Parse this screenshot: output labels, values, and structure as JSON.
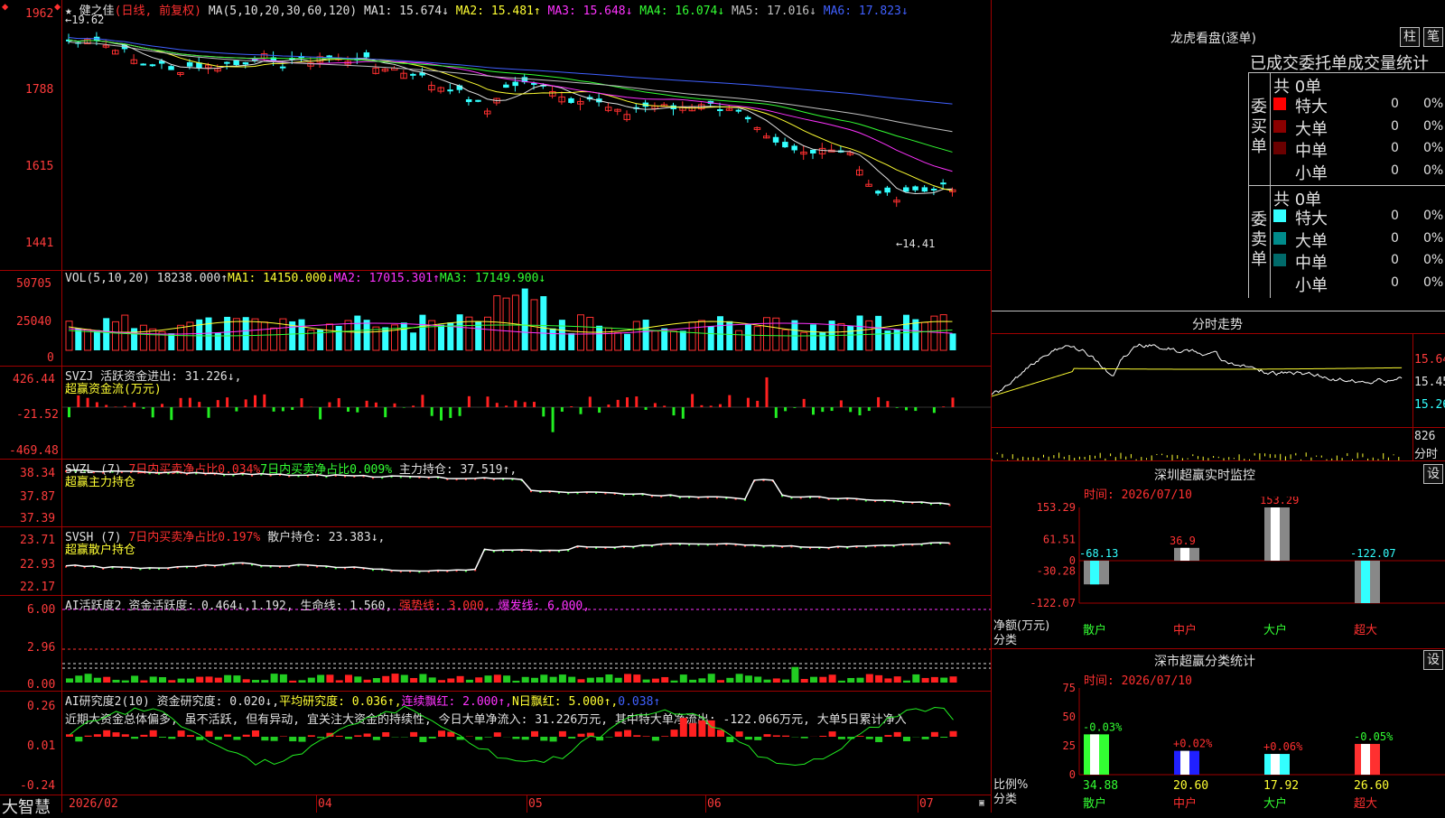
{
  "app": {
    "brand": "大智慧"
  },
  "stock": {
    "name": "健之佳",
    "mode": "(日线, 前复权)"
  },
  "price_panel": {
    "axis": [
      "1962",
      "1788",
      "1615",
      "1441"
    ],
    "ma_title": "MA(5,10,20,30,60,120)",
    "ma": [
      {
        "label": "MA1: 15.674↓",
        "color": "#e0e0e0"
      },
      {
        "label": "MA2: 15.481↑",
        "color": "#ffff33"
      },
      {
        "label": "MA3: 15.648↓",
        "color": "#ff33ff"
      },
      {
        "label": "MA4: 16.074↓",
        "color": "#33ff33"
      },
      {
        "label": "MA5: 17.016↓",
        "color": "#c0c0c0"
      },
      {
        "label": "MA6: 17.823↓",
        "color": "#4060ff"
      }
    ],
    "high_mark": "←19.62",
    "low_mark": "←14.41"
  },
  "vol_panel": {
    "axis": [
      "50705",
      "25040",
      "0"
    ],
    "title": "VOL(5,10,20)",
    "value": "18238.000↑",
    "ma1": "MA1: 14150.000↓",
    "ma2": "MA2: 17015.301↑",
    "ma3": "MA3: 17149.900↓"
  },
  "svzj_panel": {
    "axis": [
      "426.44",
      "-21.52",
      "-469.48"
    ],
    "title": "SVZJ",
    "line1": "活跃资金进出: 31.226↓,",
    "line2": "超赢资金流(万元)"
  },
  "svzl_panel": {
    "axis": [
      "38.34",
      "37.87",
      "37.39"
    ],
    "title": "SVZL (7)",
    "t1": "7日内买卖净占比0.034%",
    "t2": "7日内买卖净占比0.009%",
    "t3": "主力持仓: 37.519↑,",
    "line2": "超赢主力持仓"
  },
  "svsh_panel": {
    "axis": [
      "23.71",
      "22.93",
      "22.17"
    ],
    "title": "SVSH (7)",
    "t1": "7日内买卖净占比0.197%",
    "t2": "散户持仓: 23.383↓,",
    "line2": "超赢散户持仓"
  },
  "ai1_panel": {
    "axis": [
      "6.00",
      "2.96",
      "0.00"
    ],
    "title": "AI活跃度2",
    "t1": "资金活跃度: 0.464↓,1.192,",
    "t2": "生命线: 1.560,",
    "t3": "强势线: 3.000,",
    "t4": "爆发线: 6.000,"
  },
  "ai2_panel": {
    "axis": [
      "0.26",
      "0.01",
      "-0.24"
    ],
    "title": "AI研究度2(10)",
    "t1": "资金研究度: 0.020↓,",
    "t2": "平均研究度: 0.036↑,",
    "t3": "连续飘红: 2.000↑,",
    "t4": "N日飘红: 5.000↑,",
    "t5": "0.038↑",
    "comment": "近期大资金总体偏多, 虽不活跃, 但有异动, 宜关注大资金的持续性, 今日大单净流入: 31.226万元, 其中特大单净流出: -122.066万元, 大单5日累计净入"
  },
  "date_axis": [
    "2026/02",
    "04",
    "05",
    "06",
    "07"
  ],
  "dragon": {
    "title": "龙虎看盘(逐单)",
    "btn_bar": "柱",
    "btn_pen": "笔",
    "subtitle": "已成交委托单成交量统计",
    "buy": {
      "side_label": "委买单",
      "total": "共 0单",
      "rows": [
        {
          "name": "特大",
          "count": "0",
          "pct": "0%",
          "color": "#ff0000"
        },
        {
          "name": "大单",
          "count": "0",
          "pct": "0%",
          "color": "#8b0000"
        },
        {
          "name": "中单",
          "count": "0",
          "pct": "0%",
          "color": "#6a0000"
        },
        {
          "name": "小单",
          "count": "0",
          "pct": "0%",
          "color": "#000000"
        }
      ]
    },
    "sell": {
      "side_label": "委卖单",
      "total": "共 0单",
      "rows": [
        {
          "name": "特大",
          "count": "0",
          "pct": "0%",
          "color": "#33ffff"
        },
        {
          "name": "大单",
          "count": "0",
          "pct": "0%",
          "color": "#008b8b"
        },
        {
          "name": "中单",
          "count": "0",
          "pct": "0%",
          "color": "#006a6a"
        },
        {
          "name": "小单",
          "count": "0",
          "pct": "0%",
          "color": "#000000"
        }
      ]
    }
  },
  "intraday": {
    "title": "分时走势",
    "axis": [
      "15.64",
      "15.45",
      "15.26"
    ],
    "vol_label": "826",
    "unit": "分时"
  },
  "sz_monitor": {
    "title": "深圳超赢实时监控",
    "btn": "设",
    "time": "时间: 2026/07/10",
    "axis": [
      "153.29",
      "61.51",
      "0",
      "-30.28",
      "-122.07"
    ],
    "ylabel1": "净额(万元)",
    "ylabel2": "分类",
    "chart_data": {
      "type": "bar",
      "categories": [
        "散户",
        "中户",
        "大户",
        "超大"
      ],
      "values": [
        -68.13,
        36.9,
        153.29,
        -122.07
      ],
      "value_labels": [
        "-68.13",
        "36.9",
        "153.29",
        "-122.07"
      ],
      "ylim": [
        -122.07,
        153.29
      ]
    }
  },
  "sz_class": {
    "title": "深市超赢分类统计",
    "btn": "设",
    "time": "时间: 2026/07/10",
    "axis": [
      "75",
      "50",
      "25",
      "0"
    ],
    "ylabel1": "比例%",
    "ylabel2": "分类",
    "chart_data": {
      "type": "bar",
      "categories": [
        "散户",
        "中户",
        "大户",
        "超大"
      ],
      "values": [
        34.88,
        20.6,
        17.92,
        26.6
      ],
      "value_labels": [
        "34.88",
        "20.60",
        "17.92",
        "26.60"
      ],
      "change_labels": [
        "-0.03%",
        "+0.02%",
        "+0.06%",
        "-0.05%"
      ],
      "ylim": [
        0,
        75
      ]
    }
  }
}
